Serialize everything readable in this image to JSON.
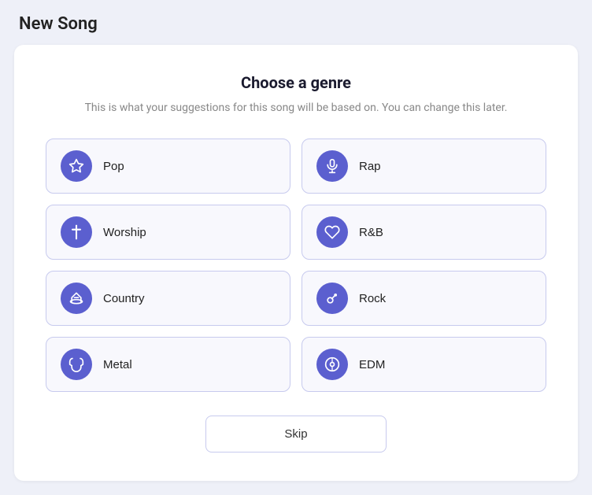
{
  "header": {
    "title": "New Song"
  },
  "card": {
    "title": "Choose a genre",
    "subtitle": "This is what your suggestions for this song will be\nbased on. You can change this later."
  },
  "genres": [
    {
      "id": "pop",
      "label": "Pop",
      "icon": "star"
    },
    {
      "id": "rap",
      "label": "Rap",
      "icon": "mic"
    },
    {
      "id": "worship",
      "label": "Worship",
      "icon": "cross"
    },
    {
      "id": "rnb",
      "label": "R&B",
      "icon": "heart"
    },
    {
      "id": "country",
      "label": "Country",
      "icon": "hat"
    },
    {
      "id": "rock",
      "label": "Rock",
      "icon": "guitar"
    },
    {
      "id": "metal",
      "label": "Metal",
      "icon": "horns"
    },
    {
      "id": "edm",
      "label": "EDM",
      "icon": "disc"
    }
  ],
  "skip_label": "Skip"
}
